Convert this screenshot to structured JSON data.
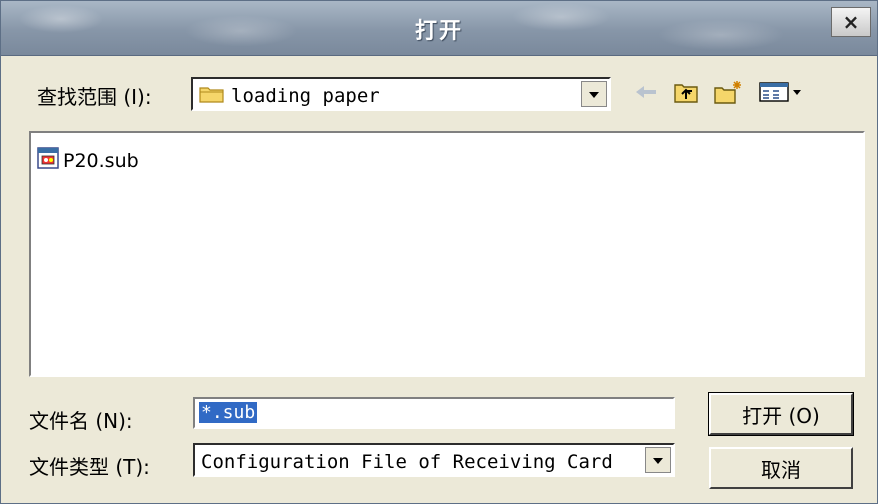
{
  "window": {
    "title": "打开",
    "close_glyph": "×"
  },
  "lookin": {
    "label": "查找范围 (I):",
    "value": "loading paper"
  },
  "toolbar": {
    "icons": [
      "back-icon",
      "up-folder-icon",
      "new-folder-icon",
      "view-menu-icon"
    ]
  },
  "files": [
    {
      "name": "P20.sub",
      "icon": "sub-file-icon"
    }
  ],
  "filename": {
    "label": "文件名 (N):",
    "value": "*.sub"
  },
  "filetype": {
    "label": "文件类型 (T):",
    "value": "Configuration File of Receiving Card"
  },
  "buttons": {
    "open": "打开 (O)",
    "cancel": "取消"
  }
}
